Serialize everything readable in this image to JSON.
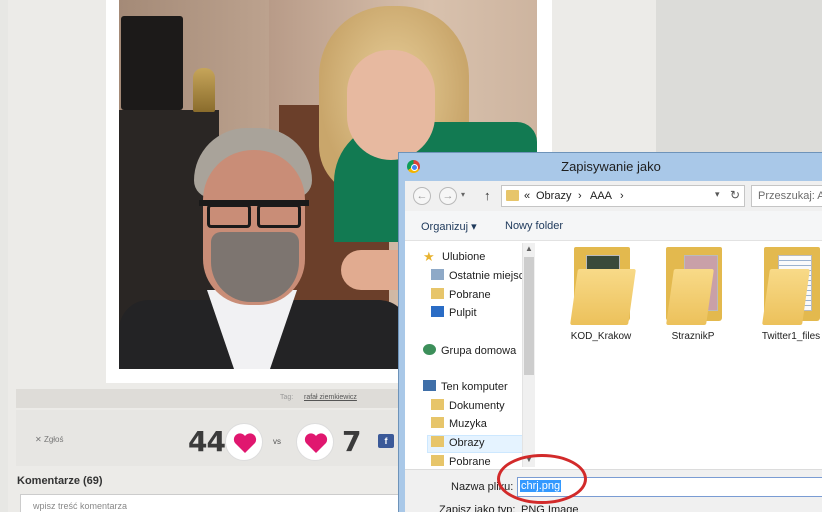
{
  "page": {
    "tag_label": "Tag:",
    "tag_link": "rafał ziemkiewicz",
    "report": "Zgłoś",
    "report_icon": "x-icon",
    "votes_up": "44",
    "vs": "vs",
    "votes_down": "7",
    "fb_letter": "f",
    "comments_title": "Komentarze (69)",
    "comment_placeholder": "wpisz treść komentarza",
    "accent_pink": "#e0176f"
  },
  "dialog": {
    "title": "Zapisywanie jako",
    "address": {
      "prefix": "«",
      "crumb1": "Obrazy",
      "crumb2": "AAA",
      "sep": "›"
    },
    "search_placeholder": "Przeszukaj: AAA",
    "toolbar": {
      "organize": "Organizuj ▾",
      "new_folder": "Nowy folder"
    },
    "nav": {
      "favorites": "Ulubione",
      "recent": "Ostatnie miejsca",
      "downloads": "Pobrane",
      "desktop": "Pulpit",
      "homegroup": "Grupa domowa",
      "this_pc": "Ten komputer",
      "documents": "Dokumenty",
      "music": "Muzyka",
      "pictures": "Obrazy",
      "downloads2": "Pobrane"
    },
    "folders": [
      "KOD_Krakow",
      "StraznikP",
      "Twitter1_files"
    ],
    "filename_label": "Nazwa pliku:",
    "filename_value": "chrj.png",
    "filetype_label": "Zapisz jako typ:",
    "filetype_value": "PNG Image"
  }
}
